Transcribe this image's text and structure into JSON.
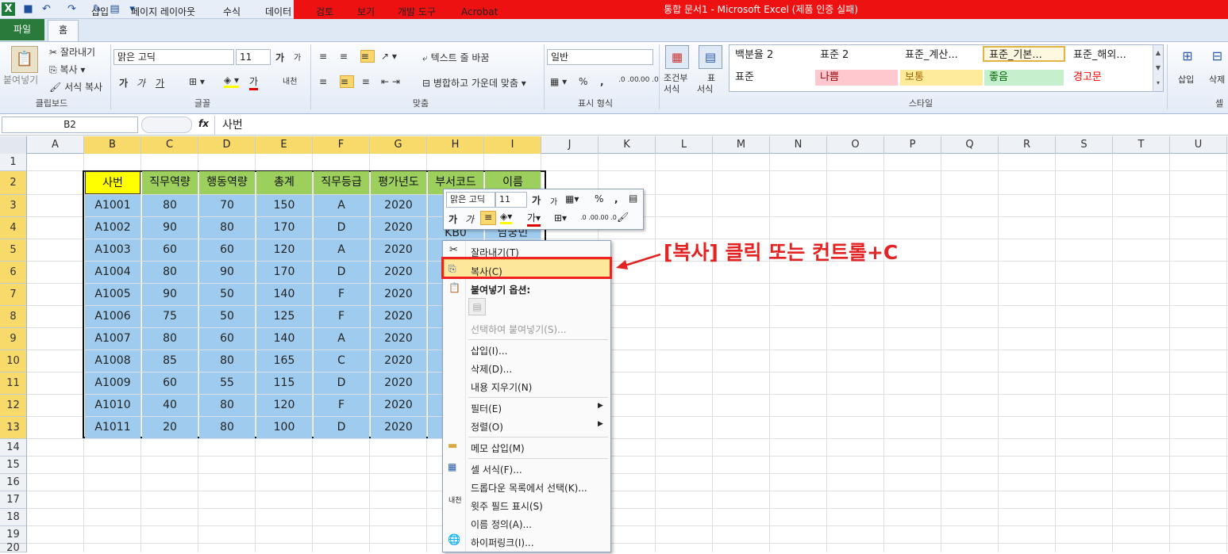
{
  "title_bar": {
    "title": "통합 문서1 - Microsoft Excel (제품 인증 실패)",
    "quick_access": [
      "save-icon",
      "undo-icon",
      "redo-icon",
      "format-painter-icon",
      "form-icon",
      "customize-icon"
    ]
  },
  "tabs": [
    "파일",
    "홈",
    "삽입",
    "페이지 레이아웃",
    "수식",
    "데이터",
    "검토",
    "보기",
    "개발 도구",
    "Acrobat"
  ],
  "ribbon": {
    "clipboard": {
      "paste": "붙여넣기",
      "cut": "잘라내기",
      "copy": "복사",
      "format_painter": "서식 복사",
      "label": "클립보드"
    },
    "font": {
      "name": "맑은 고딕",
      "size": "11",
      "grow": "가",
      "shrink": "가",
      "bold": "가",
      "italic": "가",
      "underline": "가",
      "color_letter": "가",
      "phonetic": "내천",
      "label": "글꼴"
    },
    "alignment": {
      "wrap": "텍스트 줄 바꿈",
      "merge": "병합하고 가운데 맞춤",
      "label": "맞춤"
    },
    "number": {
      "format": "일반",
      "percent": "%",
      "comma": ",",
      "inc": ".0 .00",
      "dec": ".00 .0",
      "label": "표시 형식"
    },
    "cond_format": {
      "line1": "조건부",
      "line2": "서식"
    },
    "table_format": {
      "line1": "표",
      "line2": "서식"
    },
    "styles": {
      "row1": [
        "백분율 2",
        "표준 2",
        "표준_계산...",
        "표준_기본...",
        "표준_해외..."
      ],
      "row2": [
        "표준",
        "나쁨",
        "보통",
        "좋음",
        "경고문"
      ],
      "colors": {
        "bad_bg": "#ffc7ce",
        "bad_fg": "#9c0006",
        "neutral_bg": "#ffeb9c",
        "neutral_fg": "#9c6500",
        "good_bg": "#c6efce",
        "good_fg": "#006100",
        "warn_fg": "#ff0000"
      },
      "label": "스타일"
    },
    "cells": {
      "insert": "삽입",
      "delete": "삭제",
      "label": "셀"
    }
  },
  "formula_bar": {
    "name_box": "B2",
    "fx": "fx",
    "value": "사번"
  },
  "columns": [
    "A",
    "B",
    "C",
    "D",
    "E",
    "F",
    "G",
    "H",
    "I",
    "J",
    "K",
    "L",
    "M",
    "N",
    "O",
    "P",
    "Q",
    "R",
    "S",
    "T",
    "U"
  ],
  "rows": [
    "1",
    "2",
    "3",
    "4",
    "5",
    "6",
    "7",
    "8",
    "9",
    "10",
    "11",
    "12",
    "13",
    "14",
    "15",
    "16",
    "17",
    "18",
    "19",
    "20"
  ],
  "table": {
    "headers": [
      "사번",
      "직무역량",
      "행동역량",
      "총계",
      "직무등급",
      "평가년도",
      "부서코드",
      "이름"
    ],
    "rows": [
      [
        "A1001",
        "80",
        "70",
        "150",
        "A",
        "2020"
      ],
      [
        "A1002",
        "90",
        "80",
        "170",
        "D",
        "2020"
      ],
      [
        "A1003",
        "60",
        "60",
        "120",
        "A",
        "2020"
      ],
      [
        "A1004",
        "80",
        "90",
        "170",
        "D",
        "2020"
      ],
      [
        "A1005",
        "90",
        "50",
        "140",
        "F",
        "2020"
      ],
      [
        "A1006",
        "75",
        "50",
        "125",
        "F",
        "2020"
      ],
      [
        "A1007",
        "80",
        "60",
        "140",
        "A",
        "2020"
      ],
      [
        "A1008",
        "85",
        "80",
        "165",
        "C",
        "2020"
      ],
      [
        "A1009",
        "60",
        "55",
        "115",
        "D",
        "2020"
      ],
      [
        "A1010",
        "40",
        "80",
        "120",
        "F",
        "2020"
      ],
      [
        "A1011",
        "20",
        "80",
        "100",
        "D",
        "2020"
      ]
    ],
    "partial_row4": [
      "KB0",
      "남궁민"
    ]
  },
  "mini_toolbar": {
    "font": "맑은 고딕",
    "size": "11"
  },
  "context_menu": {
    "cut": "잘라내기(T)",
    "copy": "복사(C)",
    "paste_options": "붙여넣기 옵션:",
    "paste_special": "선택하여 붙여넣기(S)...",
    "insert": "삽입(I)...",
    "delete": "삭제(D)...",
    "clear": "내용 지우기(N)",
    "filter": "필터(E)",
    "sort": "정렬(O)",
    "comment": "메모 삽입(M)",
    "format_cells": "셀 서식(F)...",
    "dropdown": "드롭다운 목록에서 선택(K)...",
    "phonetic": "윗주 필드 표시(S)",
    "define_name": "이름 정의(A)...",
    "hyperlink": "하이퍼링크(I)..."
  },
  "annotation": "[복사] 클릭 또는 컨트롤+C"
}
